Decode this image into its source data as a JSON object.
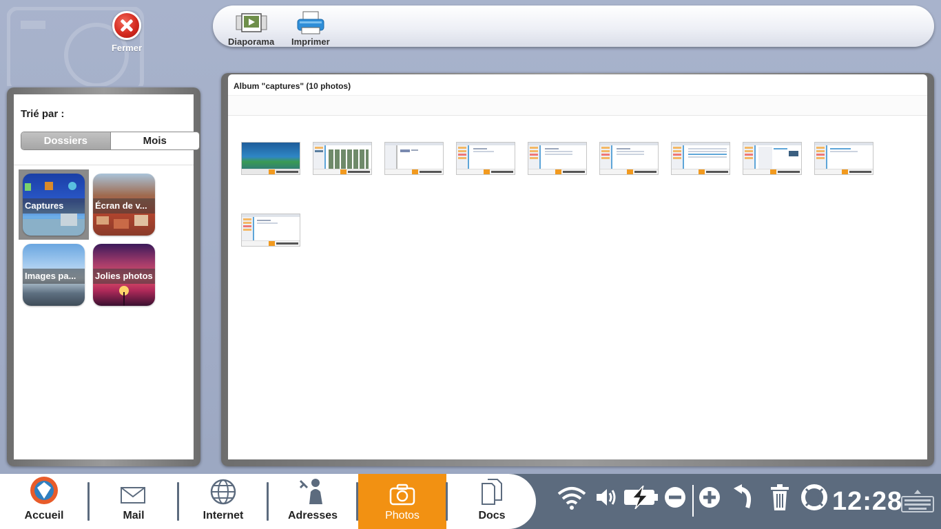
{
  "toolbar": {
    "close_label": "Fermer",
    "slideshow_label": "Diaporama",
    "print_label": "Imprimer"
  },
  "sidebar": {
    "sort_label": "Trié par :",
    "sort_options": [
      "Dossiers",
      "Mois"
    ],
    "sort_selected": "Dossiers",
    "folders": [
      {
        "label": "Captures"
      },
      {
        "label": "Écran de v..."
      },
      {
        "label": "Images pa..."
      },
      {
        "label": "Jolies photos"
      }
    ],
    "selected_folder": "Captures"
  },
  "album": {
    "title": "Album \"captures\" (10 photos)",
    "photo_count": 10
  },
  "taskbar": {
    "items": [
      {
        "label": "Accueil"
      },
      {
        "label": "Mail"
      },
      {
        "label": "Internet"
      },
      {
        "label": "Adresses"
      },
      {
        "label": "Photos"
      },
      {
        "label": "Docs"
      }
    ],
    "active_item": "Photos",
    "active_color": "#f29112",
    "clock": "12:28"
  }
}
